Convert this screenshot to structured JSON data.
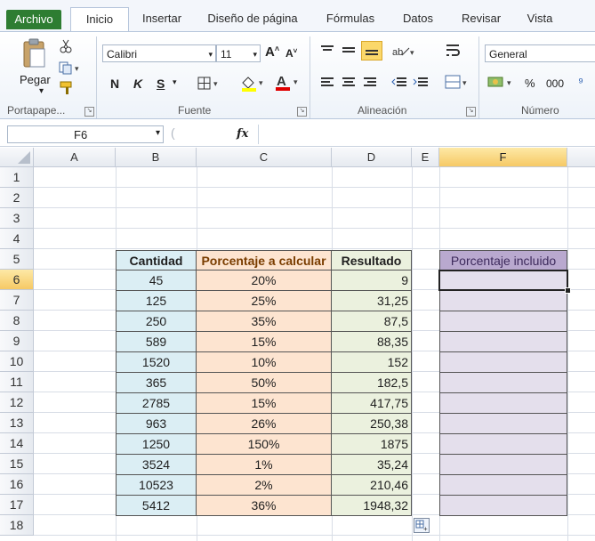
{
  "ribbon": {
    "tabs": [
      "Archivo",
      "Inicio",
      "Insertar",
      "Diseño de página",
      "Fórmulas",
      "Datos",
      "Revisar",
      "Vista"
    ],
    "active_tab": "Inicio",
    "paste_label": "Pegar",
    "font_name": "Calibri",
    "font_size": "11",
    "bold_label": "N",
    "italic_label": "K",
    "underline_label": "S",
    "number_format": "General",
    "percent_label": "%",
    "thousands_label": "000",
    "groups": [
      "Portapape...",
      "Fuente",
      "Alineación",
      "Número"
    ]
  },
  "formula_bar": {
    "name_box": "F6",
    "fx_label": "fx",
    "content": ""
  },
  "sheet": {
    "columns": [
      "A",
      "B",
      "C",
      "D",
      "E",
      "F"
    ],
    "selected_column": "F",
    "rows": [
      "1",
      "2",
      "3",
      "4",
      "5",
      "6",
      "7",
      "8",
      "9",
      "10",
      "11",
      "12",
      "13",
      "14",
      "15",
      "16",
      "17",
      "18"
    ],
    "selected_row": "6",
    "headers": {
      "cantidad": "Cantidad",
      "porcentaje": "Porcentaje a calcular",
      "resultado": "Resultado",
      "incluido": "Porcentaje incluido"
    },
    "data": [
      {
        "cantidad": "45",
        "porcentaje": "20%",
        "resultado": "9"
      },
      {
        "cantidad": "125",
        "porcentaje": "25%",
        "resultado": "31,25"
      },
      {
        "cantidad": "250",
        "porcentaje": "35%",
        "resultado": "87,5"
      },
      {
        "cantidad": "589",
        "porcentaje": "15%",
        "resultado": "88,35"
      },
      {
        "cantidad": "1520",
        "porcentaje": "10%",
        "resultado": "152"
      },
      {
        "cantidad": "365",
        "porcentaje": "50%",
        "resultado": "182,5"
      },
      {
        "cantidad": "2785",
        "porcentaje": "15%",
        "resultado": "417,75"
      },
      {
        "cantidad": "963",
        "porcentaje": "26%",
        "resultado": "250,38"
      },
      {
        "cantidad": "1250",
        "porcentaje": "150%",
        "resultado": "1875"
      },
      {
        "cantidad": "3524",
        "porcentaje": "1%",
        "resultado": "35,24"
      },
      {
        "cantidad": "10523",
        "porcentaje": "2%",
        "resultado": "210,46"
      },
      {
        "cantidad": "5412",
        "porcentaje": "36%",
        "resultado": "1948,32"
      }
    ]
  },
  "colors": {
    "file_tab": "#2e7d32",
    "cantidad_fill": "#dbeef4",
    "porcentaje_fill": "#fde4d0",
    "resultado_fill": "#ebf1de",
    "incluido_fill": "#e4dfec",
    "selection": "#f6c965"
  }
}
